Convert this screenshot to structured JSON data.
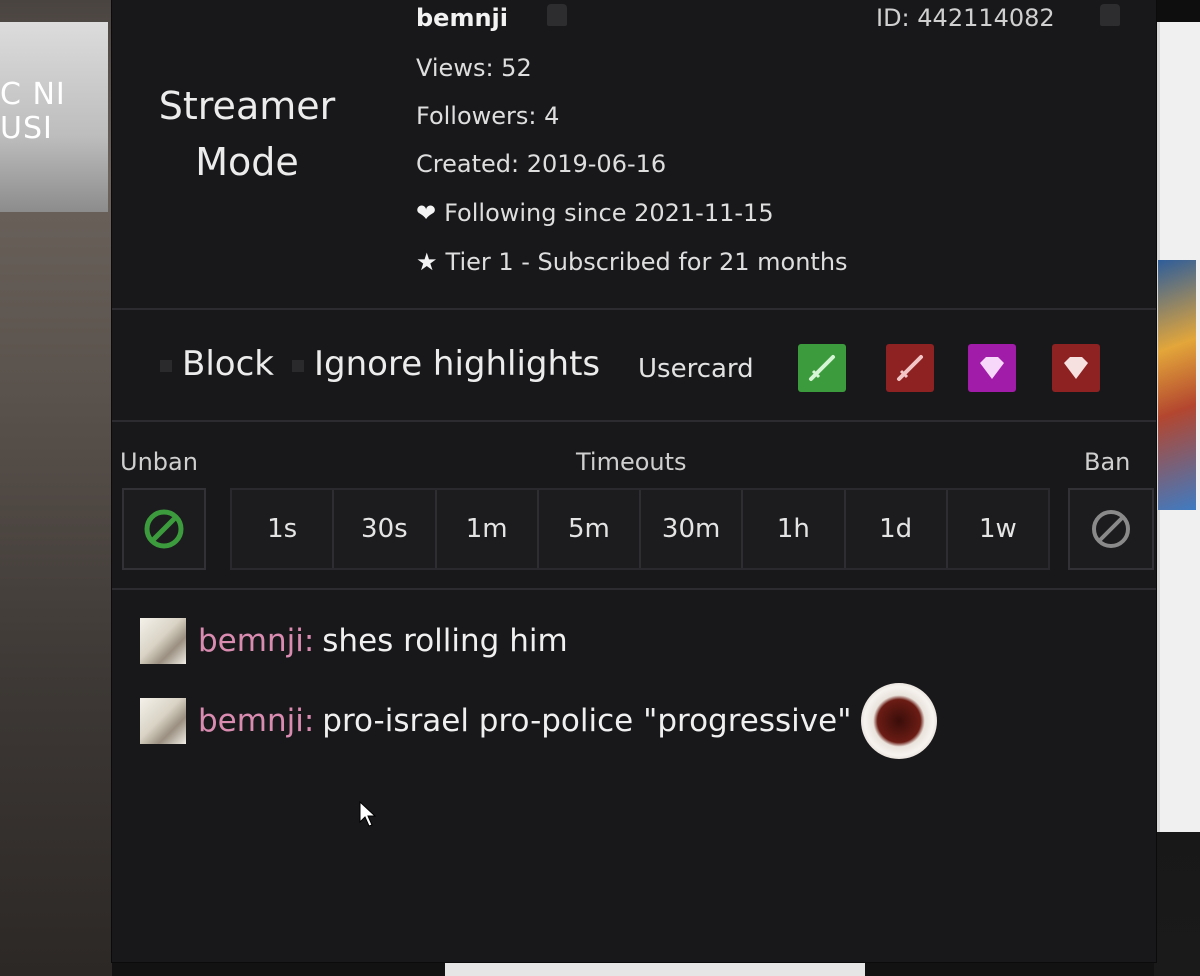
{
  "background": {
    "left_text": "C NI\nUSI"
  },
  "card": {
    "streamer_mode": "Streamer Mode",
    "username": "bemnji",
    "user_id": "ID: 442114082",
    "views": "Views: 52",
    "followers": "Followers: 4",
    "created": "Created: 2019-06-16",
    "following_icon": "heart-icon",
    "following_glyph": "❤",
    "following": "Following since 2021-11-15",
    "sub_icon": "star-icon",
    "sub_glyph": "★",
    "subscribed": "Tier 1 - Subscribed for 21 months"
  },
  "options": {
    "block": "Block",
    "ignore_highlights": "Ignore highlights",
    "usercard": "Usercard",
    "mod_buttons": [
      {
        "name": "mod-icon",
        "color": "#3c9b3c"
      },
      {
        "name": "unmod-icon",
        "color": "#8e2222"
      },
      {
        "name": "vip-icon",
        "color": "#a11ca8"
      },
      {
        "name": "unvip-icon",
        "color": "#8e2222"
      }
    ]
  },
  "moderation": {
    "unban_label": "Unban",
    "timeouts_label": "Timeouts",
    "ban_label": "Ban",
    "timeouts": [
      "1s",
      "30s",
      "1m",
      "5m",
      "30m",
      "1h",
      "1d",
      "1w"
    ],
    "unban_color": "#3c9b3c",
    "ban_color": "#8a8a8a"
  },
  "messages": [
    {
      "user": "bemnji:",
      "text": "shes rolling him",
      "emote": false
    },
    {
      "user": "bemnji:",
      "text": "pro-israel pro-police \"progressive\"",
      "emote": true
    }
  ],
  "colors": {
    "username_color": "#d98bb0",
    "background": "#18181b"
  }
}
